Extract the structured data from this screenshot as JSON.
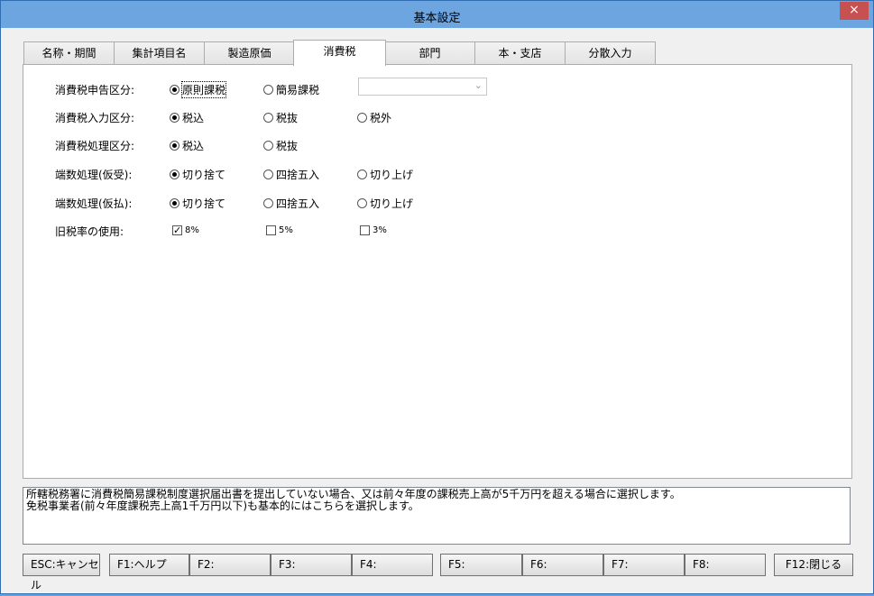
{
  "window": {
    "title": "基本設定",
    "close_glyph": "×"
  },
  "tabs": [
    {
      "label": "名称・期間"
    },
    {
      "label": "集計項目名"
    },
    {
      "label": "製造原価"
    },
    {
      "label": "消費税",
      "active": true
    },
    {
      "label": "部門"
    },
    {
      "label": "本・支店"
    },
    {
      "label": "分散入力"
    }
  ],
  "settings": {
    "rows": [
      {
        "label": "消費税申告区分:",
        "options": [
          "原則課税",
          "簡易課税"
        ],
        "selected": "原則課税",
        "combo_value": ""
      },
      {
        "label": "消費税入力区分:",
        "options": [
          "税込",
          "税抜",
          "税外"
        ],
        "selected": "税込"
      },
      {
        "label": "消費税処理区分:",
        "options": [
          "税込",
          "税抜"
        ],
        "selected": "税込"
      },
      {
        "label": "端数処理(仮受):",
        "options": [
          "切り捨て",
          "四捨五入",
          "切り上げ"
        ],
        "selected": "切り捨て"
      },
      {
        "label": "端数処理(仮払):",
        "options": [
          "切り捨て",
          "四捨五入",
          "切り上げ"
        ],
        "selected": "切り捨て"
      },
      {
        "label": "旧税率の使用:",
        "checks": [
          {
            "label": "8%",
            "checked": true
          },
          {
            "label": "5%",
            "checked": false
          },
          {
            "label": "3%",
            "checked": false
          }
        ]
      }
    ]
  },
  "description": {
    "line1": "所轄税務署に消費税簡易課税制度選択届出書を提出していない場合、又は前々年度の課税売上高が5千万円を超える場合に選択します。",
    "line2": "免税事業者(前々年度課税売上高1千万円以下)も基本的にはこちらを選択します。"
  },
  "function_keys": [
    "ESC:キャンセル",
    "F1:ヘルプ",
    "F2:",
    "F3:",
    "F4:",
    "F5:",
    "F6:",
    "F7:",
    "F8:",
    "F12:閉じる"
  ]
}
